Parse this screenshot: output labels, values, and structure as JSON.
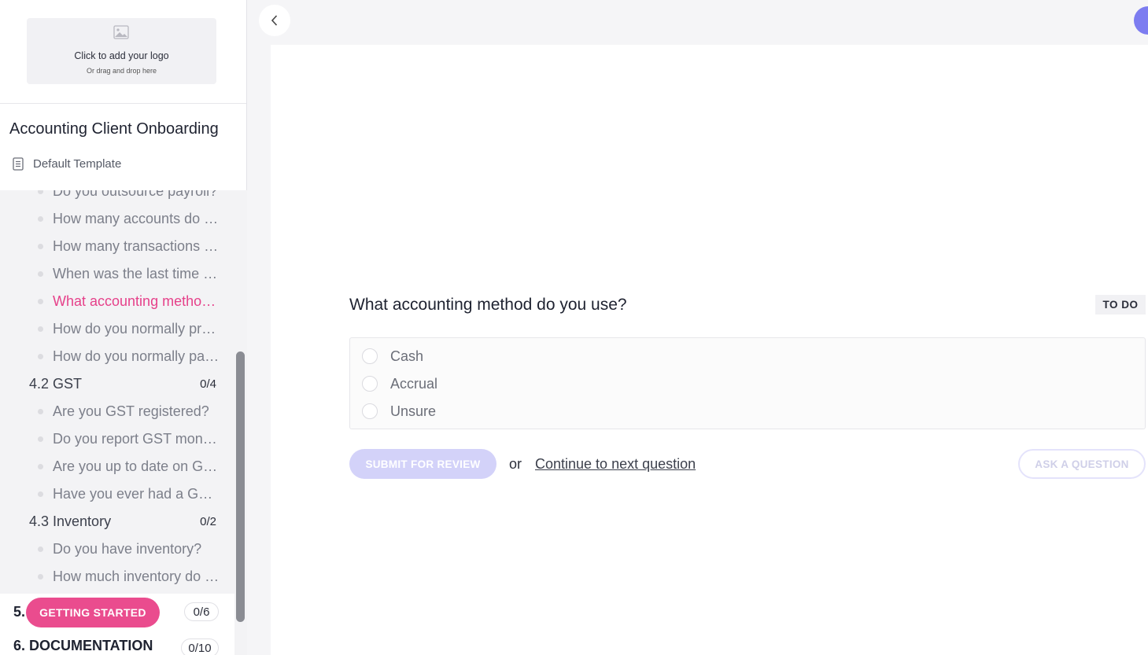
{
  "logo_upload": {
    "title": "Click to add your logo",
    "subtitle": "Or drag and drop here",
    "icon": "image-icon"
  },
  "workflow": {
    "title": "Accounting Client Onboarding",
    "template": "Default Template"
  },
  "outline": {
    "items": [
      {
        "type": "question",
        "label": "Do you outsource payroll?"
      },
      {
        "type": "question",
        "label": "How many accounts do you have?"
      },
      {
        "type": "question",
        "label": "How many transactions do you have?"
      },
      {
        "type": "question",
        "label": "When was the last time your books were reconciled?"
      },
      {
        "type": "question",
        "label": "What accounting method do you use?",
        "active": true
      },
      {
        "type": "question",
        "label": "How do you normally process payments?"
      },
      {
        "type": "question",
        "label": "How do you normally pay bills?"
      },
      {
        "type": "section",
        "label": "4.2 GST",
        "count": "0/4"
      },
      {
        "type": "question",
        "label": "Are you GST registered?"
      },
      {
        "type": "question",
        "label": "Do you report GST monthly?"
      },
      {
        "type": "question",
        "label": "Are you up to date on GST?"
      },
      {
        "type": "question",
        "label": "Have you ever had a GST audit?"
      },
      {
        "type": "section",
        "label": "4.3 Inventory",
        "count": "0/2"
      },
      {
        "type": "question",
        "label": "Do you have inventory?"
      },
      {
        "type": "question",
        "label": "How much inventory do you have?"
      }
    ]
  },
  "phases": [
    {
      "number": "5.",
      "label": "GETTING STARTED",
      "count": "0/6"
    },
    {
      "number": "6.",
      "label": "6. DOCUMENTATION",
      "count": "0/10"
    }
  ],
  "question": {
    "title": "What accounting method do you use?",
    "status": "TO DO",
    "options": [
      "Cash",
      "Accrual",
      "Unsure"
    ]
  },
  "actions": {
    "submit_label": "SUBMIT FOR REVIEW",
    "or_text": "or",
    "continue_label": "Continue to next question",
    "ask_label": "ASK A QUESTION"
  },
  "colors": {
    "accent_pink": "#ea4c8e",
    "accent_purple": "#7c7cf0",
    "submit_disabled": "#d3d2f9"
  }
}
